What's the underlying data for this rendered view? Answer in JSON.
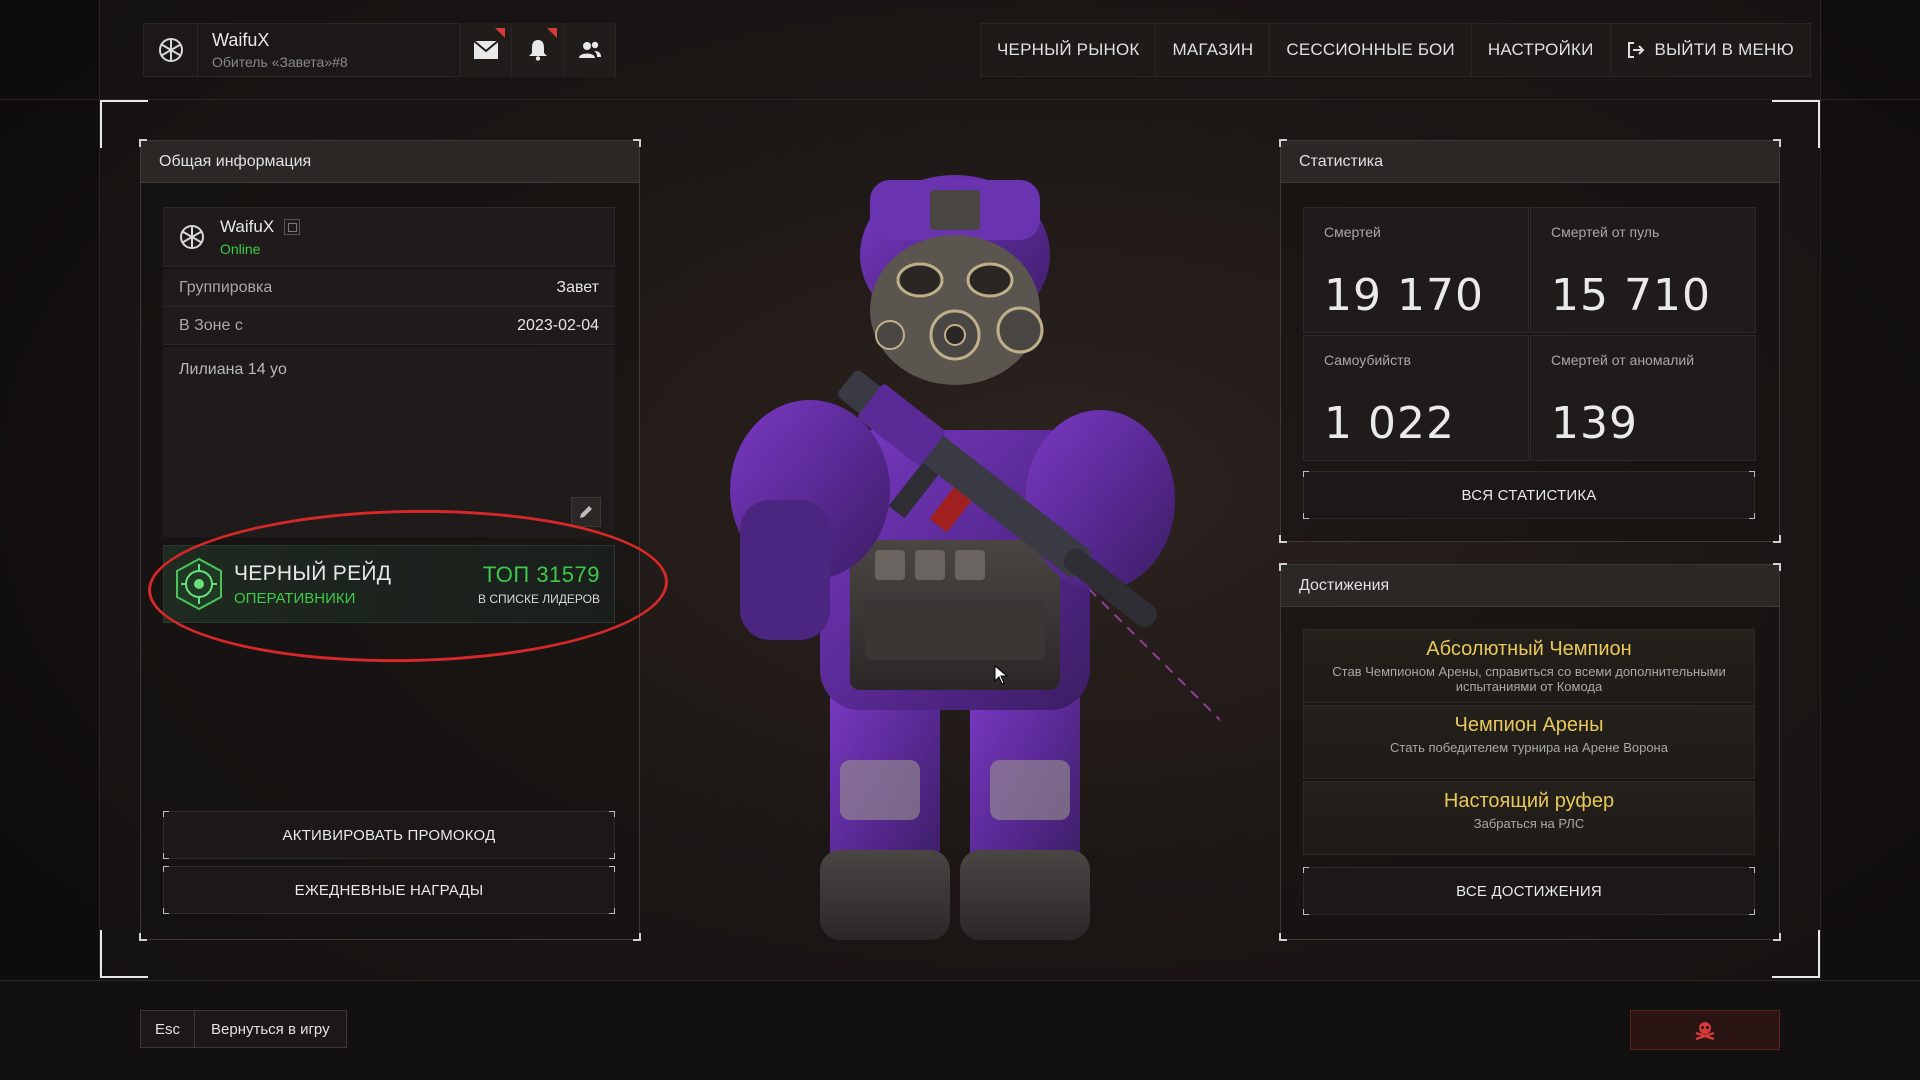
{
  "header": {
    "username": "WaifuX",
    "subtitle": "Обитель «Завета»#8",
    "icons": [
      "mail-icon",
      "bell-icon",
      "friends-icon"
    ]
  },
  "nav": {
    "items": [
      "ЧЕРНЫЙ РЫНОК",
      "МАГАЗИН",
      "СЕССИОННЫЕ БОИ",
      "НАСТРОЙКИ",
      "ВЫЙТИ В МЕНЮ"
    ]
  },
  "general": {
    "title": "Общая информация",
    "username": "WaifuX",
    "status": "Online",
    "faction_label": "Группировка",
    "faction_value": "Завет",
    "zone_label": "В Зоне с",
    "zone_value": "2023-02-04",
    "note": "Лилиана 14 yo",
    "raid_title": "ЧЕРНЫЙ РЕЙД",
    "raid_sub": "ОПЕРАТИВНИКИ",
    "raid_top": "ТОП 31579",
    "raid_list": "В СПИСКЕ ЛИДЕРОВ",
    "promo_button": "АКТИВИРОВАТЬ ПРОМОКОД",
    "daily_button": "ЕЖЕДНЕВНЫЕ НАГРАДЫ"
  },
  "stats": {
    "title": "Статистика",
    "deaths_label": "Смертей",
    "deaths_value": "19 170",
    "bullet_deaths_label": "Смертей от пуль",
    "bullet_deaths_value": "15 710",
    "suicides_label": "Самоубийств",
    "suicides_value": "1 022",
    "anomaly_deaths_label": "Смертей от аномалий",
    "anomaly_deaths_value": "139",
    "all_button": "ВСЯ СТАТИСТИКА"
  },
  "achievements": {
    "title": "Достижения",
    "items": [
      {
        "title": "Абсолютный Чемпион",
        "desc": "Став Чемпионом Арены, справиться со всеми дополнительными испытаниями от Комода"
      },
      {
        "title": "Чемпион Арены",
        "desc": "Стать победителем турнира на Арене Ворона"
      },
      {
        "title": "Настоящий руфер",
        "desc": "Забраться на РЛС"
      }
    ],
    "all_button": "ВСЕ ДОСТИЖЕНИЯ"
  },
  "footer": {
    "esc_key": "Esc",
    "return_label": "Вернуться в игру"
  },
  "colors": {
    "online": "#3fc94a",
    "achievement_title": "#e8c85a",
    "highlight_ellipse": "#d62828",
    "accent_purple": "#6a2fb0"
  }
}
